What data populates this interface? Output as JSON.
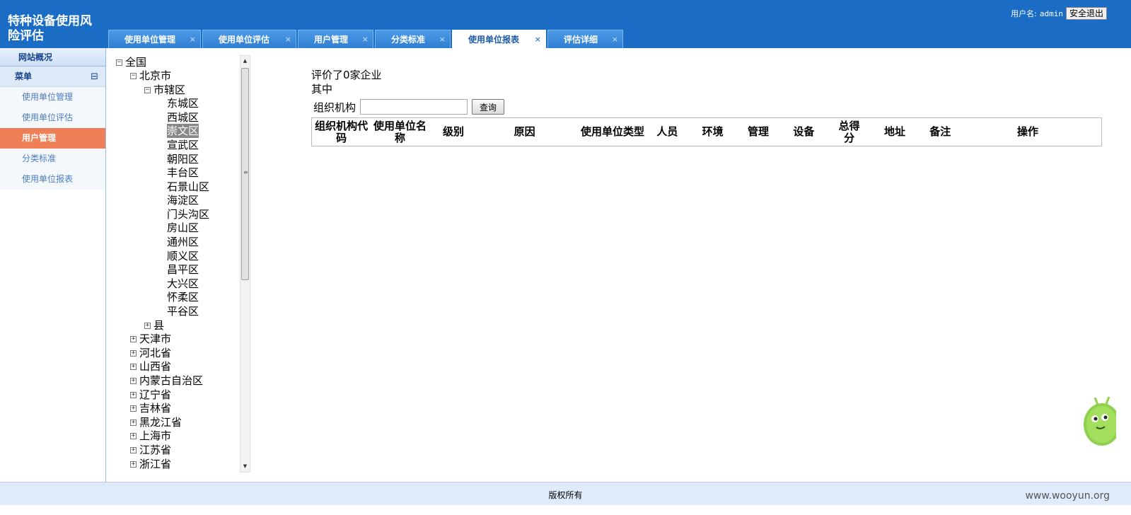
{
  "header": {
    "app_title": "特种设备使用风险评估",
    "user_label": "用户名:",
    "username": "admin",
    "logout_label": "安全退出",
    "tabs": [
      {
        "label": "使用单位管理",
        "close": "×",
        "active": false
      },
      {
        "label": "使用单位评估",
        "close": "×",
        "active": false
      },
      {
        "label": "用户管理",
        "close": "×",
        "active": false
      },
      {
        "label": "分类标准",
        "close": "×",
        "active": false
      },
      {
        "label": "使用单位报表",
        "close": "×",
        "active": true
      },
      {
        "label": "评估详细",
        "close": "×",
        "active": false
      }
    ]
  },
  "sidebar": {
    "overview": "网站概况",
    "menu_title": "菜单",
    "collapse_glyph": "⊟",
    "items": [
      {
        "label": "使用单位管理",
        "active": false
      },
      {
        "label": "使用单位评估",
        "active": false
      },
      {
        "label": "用户管理",
        "active": true
      },
      {
        "label": "分类标准",
        "active": false
      },
      {
        "label": "使用单位报表",
        "active": false
      }
    ]
  },
  "tree": {
    "root": "全国",
    "beijing": "北京市",
    "shixiaqu": "市辖区",
    "districts": [
      "东城区",
      "西城区",
      "崇文区",
      "宣武区",
      "朝阳区",
      "丰台区",
      "石景山区",
      "海淀区",
      "门头沟区",
      "房山区",
      "通州区",
      "顺义区",
      "昌平区",
      "大兴区",
      "怀柔区",
      "平谷区"
    ],
    "selected_district": "崇文区",
    "county": "县",
    "provinces": [
      "天津市",
      "河北省",
      "山西省",
      "内蒙古自治区",
      "辽宁省",
      "吉林省",
      "黑龙江省",
      "上海市",
      "江苏省",
      "浙江省"
    ]
  },
  "main": {
    "summary_line1": "评价了0家企业",
    "summary_line2": "其中",
    "search_label": "组织机构",
    "search_value": "",
    "query_label": "查询",
    "columns": [
      "组织机构代码",
      "使用单位名称",
      "级别",
      "原因",
      "使用单位类型",
      "人员",
      "环境",
      "管理",
      "设备",
      "总得分",
      "地址",
      "备注",
      "操作"
    ]
  },
  "footer": {
    "copyright": "版权所有",
    "watermark": "www.wooyun.org"
  }
}
